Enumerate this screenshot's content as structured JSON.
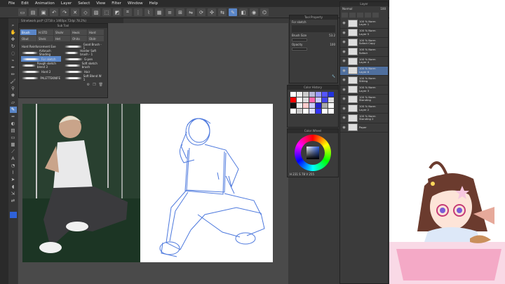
{
  "menu": [
    "File",
    "Edit",
    "Animation",
    "Layer",
    "Select",
    "View",
    "Filter",
    "Window",
    "Help"
  ],
  "doc_tab": "Sitnetwork.psd* (2718 x 1460px 72dpi 78.2%)",
  "subtool": {
    "title": "Sub Tool",
    "tabs": [
      "Brush",
      "H.STD",
      "Shohr",
      "Hwsk",
      "Hard",
      "Obut",
      "Shelc",
      "Het",
      "Ohito",
      "Obitr"
    ],
    "brushes": [
      "Hard Reinforcement Exe",
      "Good Brush - 1",
      "Airbrush Shading",
      "Harder Soft brush - 1",
      "For sketch",
      "G-pen",
      "Rough sketch blend 3",
      "Soft sketch brush",
      "Hard 2",
      "Hair",
      "PALETTEKNIFE",
      "Soft Blend W 1"
    ]
  },
  "tool_property": {
    "title": "Tool Property",
    "brush_name": "For sketch",
    "brush_size_label": "Brush Size",
    "brush_size": "53.2",
    "opacity_label": "Opacity",
    "opacity": "100"
  },
  "color_history": {
    "title": "Color History",
    "colors": [
      "#ffffff",
      "#eeeeee",
      "#cccccc",
      "#b8b8d8",
      "#9999ff",
      "#5555ff",
      "#2233dd",
      "#ff0000",
      "#ffffff",
      "#dddddd",
      "#ff66aa",
      "#ccccff",
      "#4444ee",
      "#dddddd",
      "#111111",
      "#eeeeee",
      "#ffcccc",
      "#ccccff",
      "#2222cc",
      "#aaaaaa",
      "#ffffff",
      "#ffffff",
      "#cccccc",
      "#ffffff",
      "#ddddff",
      "#3333ff",
      "#ffffff",
      "#ffffff"
    ]
  },
  "color_wheel": {
    "title": "Color Wheel",
    "values": "H 231  S 78  V 255"
  },
  "layers": {
    "title": "Layer",
    "blend": "Normal",
    "opacity": "100",
    "items": [
      {
        "name": "100 % Norm\nLayer 1"
      },
      {
        "name": "100 % Norm\nLayer 5"
      },
      {
        "name": "100 % Norm\nSofact Copy"
      },
      {
        "name": "100 % Norm\nSofact"
      },
      {
        "name": "100 % Norm\nLayer 4"
      },
      {
        "name": "100 % Norm\nLayer 6"
      },
      {
        "name": "100 % Norm\nSitting"
      },
      {
        "name": "100 % Norm\nLayer 3"
      },
      {
        "name": "100 % Norm\nStanding"
      },
      {
        "name": "100 % Norm\nLayer 2"
      },
      {
        "name": "100 % Norm\nStanding 2"
      },
      {
        "name": "Paper"
      }
    ]
  },
  "colors": {
    "accent": "#5a86c8",
    "sketch_line": "#2f62d8"
  }
}
